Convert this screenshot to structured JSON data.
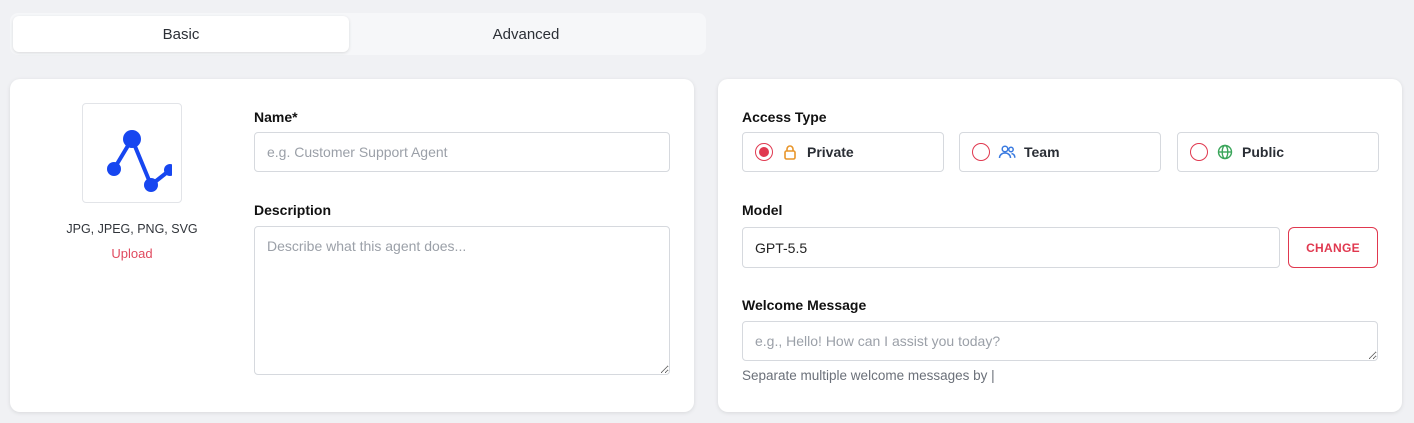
{
  "tabs": [
    {
      "label": "Basic",
      "active": true
    },
    {
      "label": "Advanced",
      "active": false
    }
  ],
  "left": {
    "logo_icon": "agent-network-logo",
    "formats": "JPG, JPEG, PNG, SVG",
    "upload_label": "Upload",
    "name_label": "Name*",
    "name_placeholder": "e.g. Customer Support Agent",
    "name_value": "",
    "description_label": "Description",
    "description_placeholder": "Describe what this agent does...",
    "description_value": ""
  },
  "right": {
    "access_label": "Access Type",
    "access_options": [
      {
        "label": "Private",
        "icon": "lock-icon",
        "selected": true
      },
      {
        "label": "Team",
        "icon": "team-icon",
        "selected": false
      },
      {
        "label": "Public",
        "icon": "globe-icon",
        "selected": false
      }
    ],
    "model_label": "Model",
    "model_value": "GPT-5.5",
    "change_label": "CHANGE",
    "welcome_label": "Welcome Message",
    "welcome_placeholder": "e.g., Hello! How can I assist you today?",
    "welcome_value": "",
    "welcome_hint": "Separate multiple welcome messages by |"
  },
  "colors": {
    "accent": "#e0384f",
    "logo_blue": "#1746f0",
    "lock_orange": "#e8952a",
    "team_blue": "#3b7be0",
    "globe_green": "#3aa55a"
  }
}
